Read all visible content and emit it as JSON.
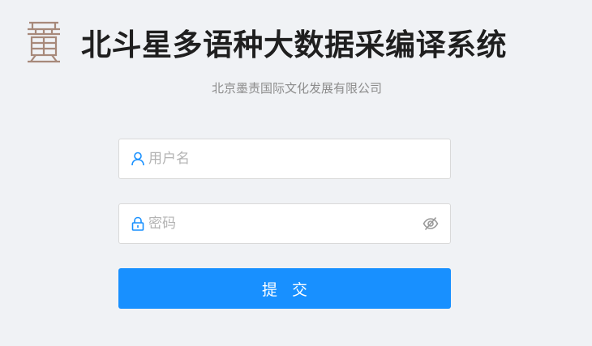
{
  "header": {
    "title": "北斗星多语种大数据采编译系统",
    "subtitle": "北京墨责国际文化发展有限公司"
  },
  "login": {
    "username_placeholder": "用户名",
    "password_placeholder": "密码",
    "submit_label": "提 交"
  },
  "colors": {
    "accent": "#1890ff",
    "background": "#f0f2f5",
    "logo": "#a7897a"
  },
  "icons": {
    "logo": "seal-logo-icon",
    "username": "user-icon",
    "password": "lock-icon",
    "toggle": "eye-off-icon"
  }
}
